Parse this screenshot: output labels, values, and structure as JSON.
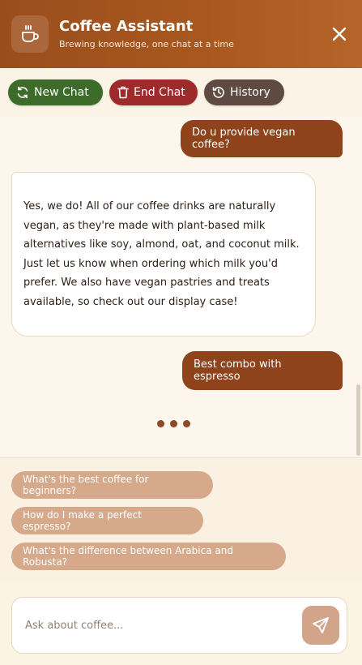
{
  "header": {
    "title": "Coffee Assistant",
    "subtitle": "Brewing knowledge, one chat at a time",
    "logo_icon": "coffee-cup-icon",
    "close_icon": "close-icon"
  },
  "actions": {
    "new_chat": "New Chat",
    "end_chat": "End Chat",
    "history": "History"
  },
  "messages": [
    {
      "role": "user",
      "text": "Do u provide vegan coffee?"
    },
    {
      "role": "assistant",
      "text": "Yes, we do! All of our coffee drinks are naturally vegan, as they're made with plant-based milk alternatives like soy, almond, oat, and coconut milk. Just let us know when ordering which milk you'd prefer. We also have vegan pastries and treats available, so check out our display case!"
    },
    {
      "role": "user",
      "text": "Best combo with espresso"
    }
  ],
  "suggestions": [
    "What's the best coffee for beginners?",
    "How do I make a perfect espresso?",
    "What's the difference between Arabica and Robusta?"
  ],
  "composer": {
    "placeholder": "Ask about coffee...",
    "send_icon": "send-icon"
  },
  "colors": {
    "header": "#a9591f",
    "new_chat": "#3d6b2a",
    "end_chat": "#9e2b2b",
    "history": "#5e4a40",
    "user_bubble": "#8f431b",
    "suggestion_chip": "#d7a98b",
    "send_button": "#d2a58a"
  }
}
